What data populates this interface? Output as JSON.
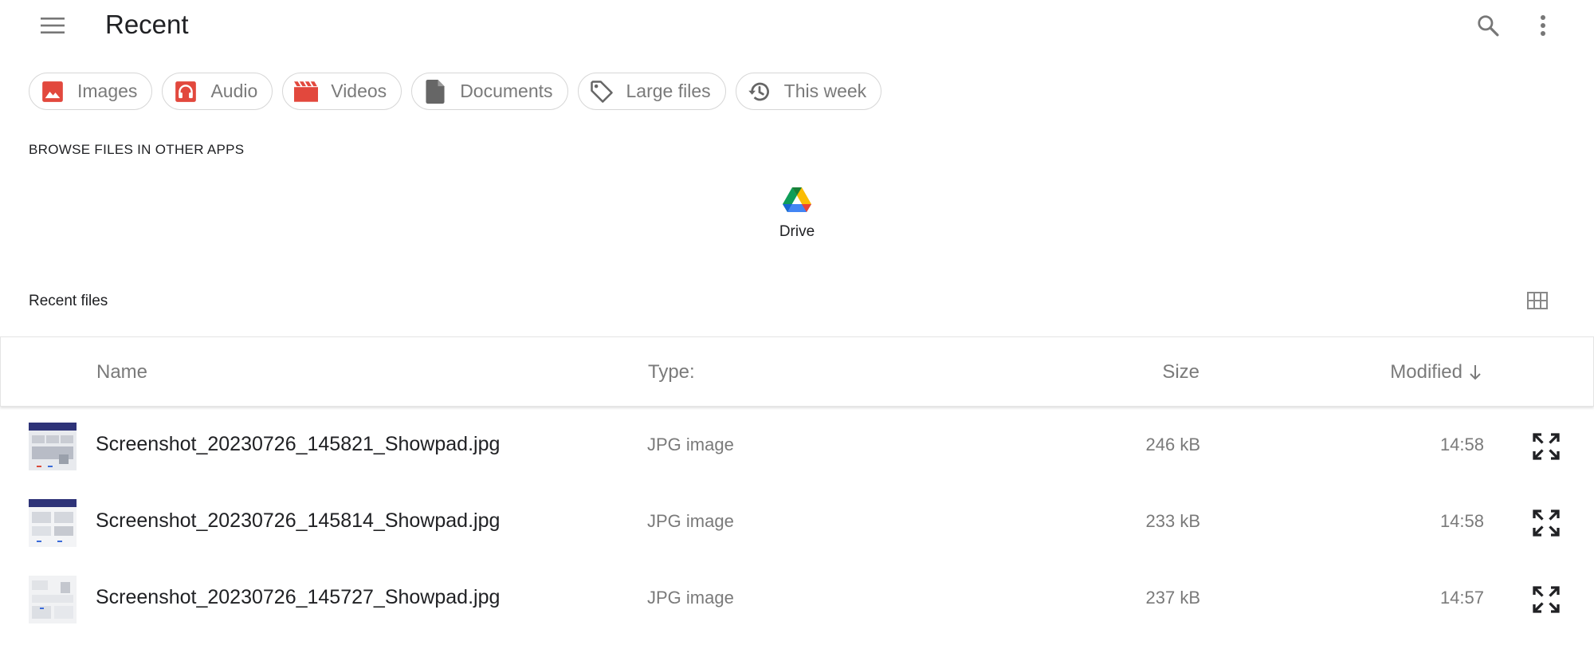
{
  "app": {
    "title": "Recent"
  },
  "chips": [
    {
      "label": "Images",
      "icon": "image-icon",
      "color": "#e2483d"
    },
    {
      "label": "Audio",
      "icon": "headphones-icon",
      "color": "#e2483d"
    },
    {
      "label": "Videos",
      "icon": "movie-icon",
      "color": "#e2483d"
    },
    {
      "label": "Documents",
      "icon": "document-icon",
      "color": "#666666"
    },
    {
      "label": "Large files",
      "icon": "tag-icon",
      "color": "#666666"
    },
    {
      "label": "This week",
      "icon": "history-icon",
      "color": "#666666"
    }
  ],
  "browse": {
    "heading": "BROWSE FILES IN OTHER APPS",
    "apps": [
      {
        "label": "Drive",
        "icon": "google-drive-icon"
      }
    ]
  },
  "recent": {
    "heading": "Recent files",
    "columns": {
      "name": "Name",
      "type": "Type:",
      "size": "Size",
      "modified": "Modified"
    },
    "sort_icon": "arrow-down-icon",
    "files": [
      {
        "name": "Screenshot_20230726_145821_Showpad.jpg",
        "type": "JPG image",
        "size": "246 kB",
        "modified": "14:58"
      },
      {
        "name": "Screenshot_20230726_145814_Showpad.jpg",
        "type": "JPG image",
        "size": "233 kB",
        "modified": "14:58"
      },
      {
        "name": "Screenshot_20230726_145727_Showpad.jpg",
        "type": "JPG image",
        "size": "237 kB",
        "modified": "14:57"
      }
    ]
  },
  "colors": {
    "accent_red": "#e2483d",
    "icon_gray": "#666666",
    "text_gray": "#7a7a7a",
    "thumb_header": "#2e3378"
  }
}
